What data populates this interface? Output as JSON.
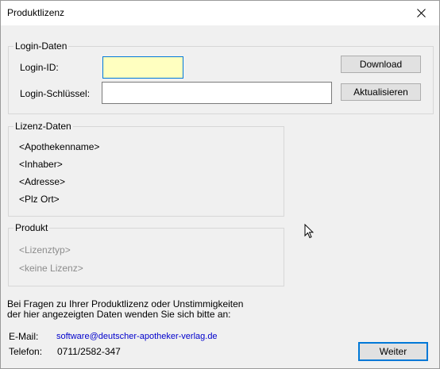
{
  "window": {
    "title": "Produktlizenz",
    "close_glyph": "✕"
  },
  "login": {
    "group_title": "Login-Daten",
    "id_label": "Login-ID:",
    "id_value": "",
    "key_label": "Login-Schlüssel:",
    "key_value": "",
    "download_label": "Download",
    "update_label": "Aktualisieren"
  },
  "license": {
    "group_title": "Lizenz-Daten",
    "pharmacy_name": "<Apothekenname>",
    "owner": "<Inhaber>",
    "address": "<Adresse>",
    "city": "<Plz Ort>"
  },
  "product": {
    "group_title": "Produkt",
    "license_type": "<Lizenztyp>",
    "license_status": "<keine Lizenz>"
  },
  "info": {
    "line1": "Bei Fragen zu Ihrer Produktlizenz oder Unstimmigkeiten",
    "line2": "der hier angezeigten Daten wenden Sie sich bitte an:",
    "email_label": "E-Mail:",
    "email_value": "software@deutscher-apotheker-verlag.de",
    "phone_label": "Telefon:",
    "phone_value": "0711/2582-347"
  },
  "footer": {
    "continue_label": "Weiter"
  },
  "colors": {
    "focus_border": "#0078d7",
    "focus_fill": "#ffffc0",
    "link": "#0000cc",
    "disabled_text": "#8c8c8c"
  },
  "icons": {
    "close": "close-icon",
    "cursor": "mouse-pointer-icon"
  }
}
